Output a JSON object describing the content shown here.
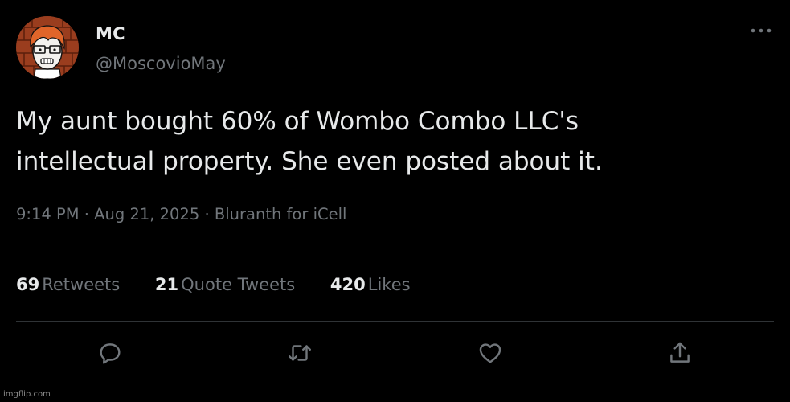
{
  "author": {
    "display_name": "MC",
    "handle": "@MoscovioMay",
    "avatar_icon": "avatar-cartoon-glasses"
  },
  "tweet": {
    "text_lines": [
      "My aunt bought 60% of Wombo Combo LLC's",
      "intellectual property. She even posted about it."
    ],
    "meta": "9:14 PM · Aug 21, 2025 · Bluranth for iCell"
  },
  "stats": {
    "retweets": {
      "count": "69",
      "label": "Retweets"
    },
    "quote_tweets": {
      "count": "21",
      "label": "Quote Tweets"
    },
    "likes": {
      "count": "420",
      "label": "Likes"
    }
  },
  "actions": [
    "reply-icon",
    "retweet-icon",
    "like-icon",
    "share-icon"
  ],
  "menu_icon": "more-options-icon",
  "watermark": "imgflip.com",
  "colors": {
    "background": "#000000",
    "primary_text": "#e7e9ea",
    "secondary_text": "#71767b",
    "divider": "#2f3336"
  }
}
